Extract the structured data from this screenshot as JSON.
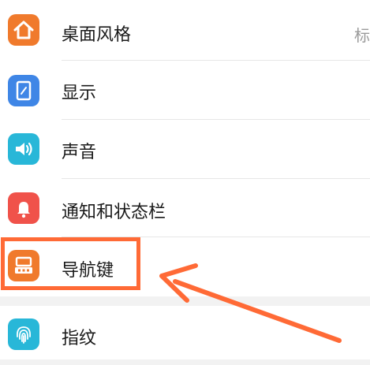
{
  "settings": {
    "items": [
      {
        "label": "桌面风格",
        "value": "标",
        "icon": "home-icon",
        "color": "#f07a2c"
      },
      {
        "label": "显示",
        "icon": "display-icon",
        "color": "#3f86e6"
      },
      {
        "label": "声音",
        "icon": "speaker-icon",
        "color": "#28b7d8"
      },
      {
        "label": "通知和状态栏",
        "icon": "bell-icon",
        "color": "#f0524a"
      },
      {
        "label": "导航键",
        "icon": "navigation-key-icon",
        "color": "#f07a2c"
      },
      {
        "label": "指纹",
        "icon": "fingerprint-icon",
        "color": "#28b7d8"
      }
    ]
  },
  "annotation": {
    "color": "#ff6a36",
    "target": "导航键"
  }
}
